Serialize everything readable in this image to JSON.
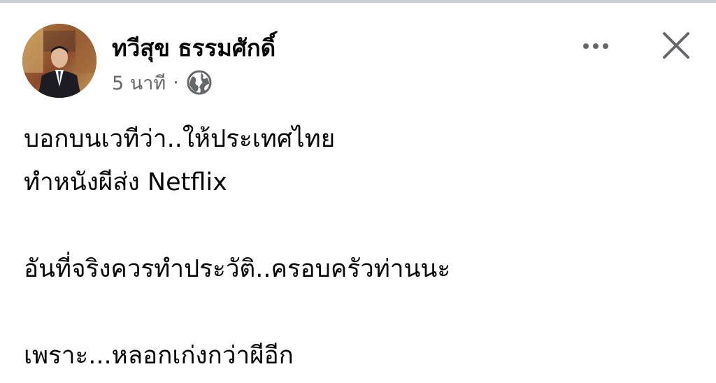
{
  "post": {
    "author": "ทวีสุข ธรรมศักดิ์",
    "time": "5 นาที",
    "separator": "·",
    "privacy_icon": "globe-icon",
    "lines": [
      "บอกบนเวทีว่า..ให้ประเทศไทย",
      "ทำหนังผีส่ง Netflix",
      "",
      "อันที่จริงควรทำประวัติ..ครอบครัวท่านนะ",
      "",
      "เพราะ...หลอกเก่งกว่าผีอีก"
    ]
  },
  "actions": {
    "more_icon": "more-horizontal-icon",
    "close_icon": "close-icon"
  },
  "colors": {
    "text": "#050505",
    "secondary": "#65676b",
    "divider": "#c9ccd1"
  }
}
